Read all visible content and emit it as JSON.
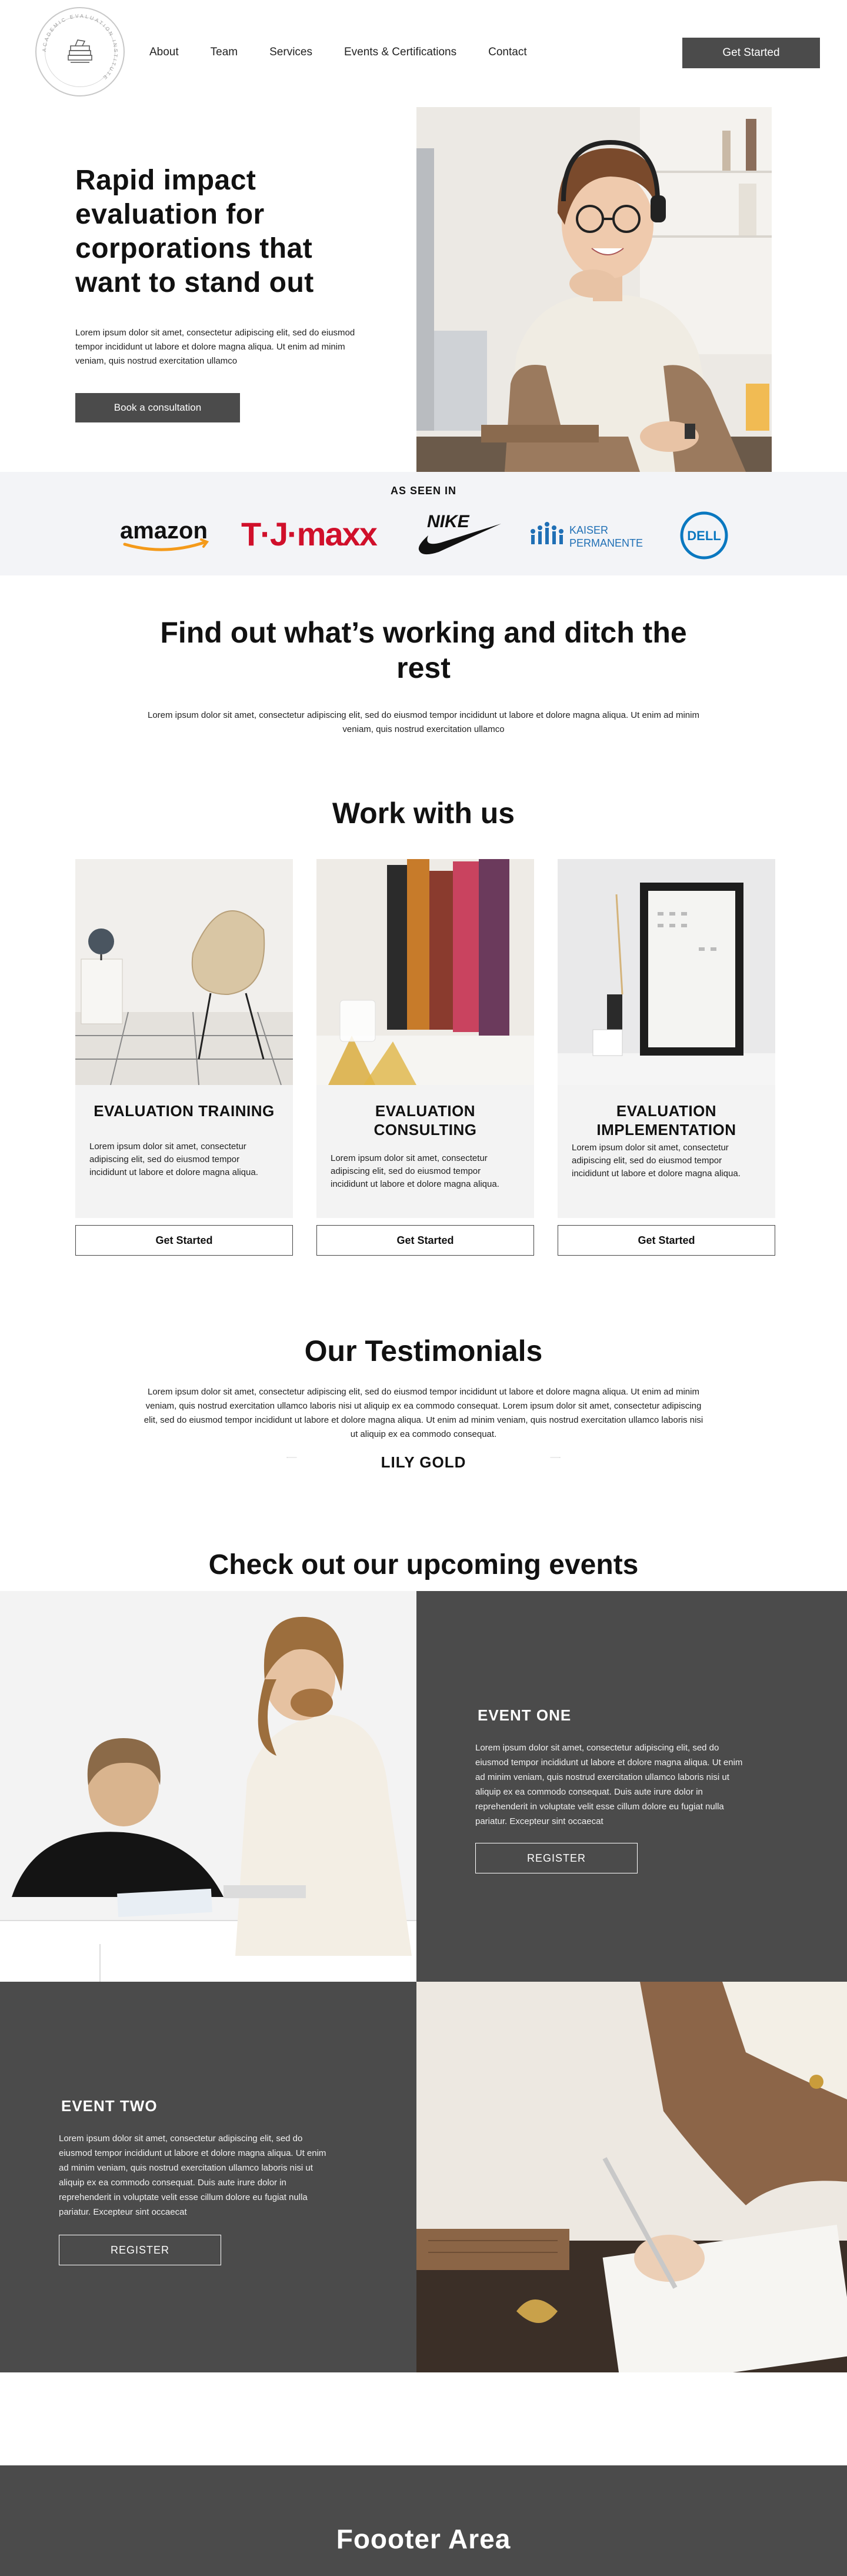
{
  "nav": {
    "logo_ring_text": "ACADEMIC EVALUATION INSTITUTE",
    "links": [
      "About",
      "Team",
      "Services",
      "Events & Certifications",
      "Contact"
    ],
    "cta": "Get Started"
  },
  "hero": {
    "title": "Rapid impact evaluation for corporations that want to stand out",
    "body": "Lorem ipsum dolor sit amet, consectetur adipiscing elit, sed do eiusmod tempor incididunt ut labore et dolore magna aliqua. Ut enim ad minim veniam, quis nostrud exercitation ullamco",
    "button": "Book a consultation"
  },
  "seen_in": {
    "title": "AS SEEN IN",
    "brands": {
      "amazon": "amazon",
      "tjmaxx": "T·J·maxx",
      "nike": "NIKE",
      "kaiser_line1": "KAISER",
      "kaiser_line2": "PERMANENTE",
      "dell": "DELL"
    }
  },
  "find_out": {
    "title": "Find out what’s working and ditch the rest",
    "body": "Lorem ipsum dolor sit amet, consectetur adipiscing elit, sed do eiusmod tempor incididunt ut labore et dolore magna aliqua. Ut enim ad minim veniam, quis nostrud exercitation ullamco"
  },
  "work_with_us": {
    "title": "Work with us",
    "cards": [
      {
        "title": "EVALUATION TRAINING",
        "body": "Lorem ipsum dolor sit amet, consectetur adipiscing elit, sed do eiusmod tempor incididunt ut labore et dolore magna aliqua.",
        "button": "Get Started"
      },
      {
        "title": "EVALUATION CONSULTING",
        "body": "Lorem ipsum dolor sit amet, consectetur adipiscing elit, sed do eiusmod tempor incididunt ut labore et dolore magna aliqua.",
        "button": "Get Started"
      },
      {
        "title": "EVALUATION IMPLEMENTATION",
        "body": "Lorem ipsum dolor sit amet, consectetur adipiscing elit, sed do eiusmod tempor incididunt ut labore et dolore magna aliqua.",
        "button": "Get Started"
      }
    ]
  },
  "testimonials": {
    "title": "Our Testimonials",
    "body": "Lorem ipsum dolor sit amet, consectetur adipiscing elit, sed do eiusmod tempor incididunt ut labore et dolore magna aliqua. Ut enim ad minim veniam, quis nostrud exercitation ullamco laboris nisi ut aliquip ex ea commodo consequat. Lorem ipsum dolor sit amet, consectetur adipiscing elit, sed do eiusmod tempor incididunt ut labore et dolore magna aliqua. Ut enim ad minim veniam, quis nostrud exercitation ullamco laboris nisi ut aliquip ex ea commodo consequat.",
    "name": "LILY GOLD"
  },
  "events": {
    "title": "Check out our upcoming events",
    "items": [
      {
        "title": "EVENT ONE",
        "body": "Lorem ipsum dolor sit amet, consectetur adipiscing elit, sed do eiusmod tempor incididunt ut labore et dolore magna aliqua. Ut enim ad minim veniam, quis nostrud exercitation ullamco laboris nisi ut aliquip ex ea commodo consequat. Duis aute irure dolor in reprehenderit in voluptate velit esse cillum dolore eu fugiat nulla pariatur. Excepteur sint occaecat",
        "button": "REGISTER"
      },
      {
        "title": "EVENT TWO",
        "body": "Lorem ipsum dolor sit amet, consectetur adipiscing elit, sed do eiusmod tempor incididunt ut labore et dolore magna aliqua. Ut enim ad minim veniam, quis nostrud exercitation ullamco laboris nisi ut aliquip ex ea commodo consequat. Duis aute irure dolor in reprehenderit in voluptate velit esse cillum dolore eu fugiat nulla pariatur. Excepteur sint occaecat",
        "button": "REGISTER"
      }
    ]
  },
  "footer": {
    "title": "Foooter Area"
  },
  "colors": {
    "dark": "#4b4b4b",
    "light_band": "#f3f4f7",
    "card_bg": "#f3f3f3",
    "tjmaxx_red": "#d0102b",
    "kaiser_blue": "#1f6fb5",
    "dell_blue": "#0a78c0",
    "amazon_orange": "#f49a1a"
  }
}
